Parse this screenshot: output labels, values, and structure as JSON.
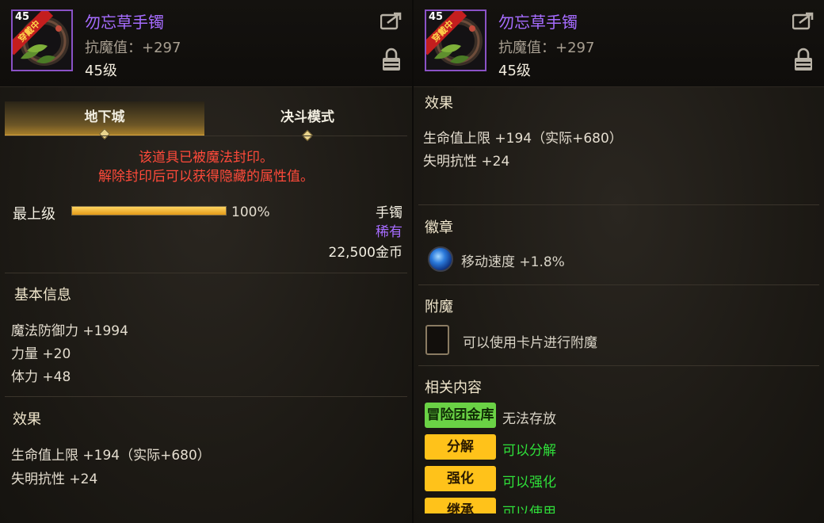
{
  "item": {
    "name": "勿忘草手镯",
    "stat": "抗魔值：+297",
    "level": "45级",
    "level_tag": "45",
    "equipped_ribbon": "穿戴中"
  },
  "left": {
    "tabs": [
      {
        "label": "地下城",
        "active": true
      },
      {
        "label": "决斗模式",
        "active": false
      }
    ],
    "seal_message": [
      "该道具已被魔法封印。",
      "解除封印后可以获得隐藏的属性值。"
    ],
    "upgrade": {
      "label": "最上级",
      "percent_text": "100%",
      "progress": 1.0
    },
    "category": "手镯",
    "rarity": "稀有",
    "price": "22,500金币",
    "basic_info": {
      "title": "基本信息",
      "lines": [
        "魔法防御力 +1994",
        "力量 +20",
        "体力 +48"
      ]
    },
    "effects": {
      "title": "效果",
      "lines": [
        "生命值上限 +194（实际+680）",
        "失明抗性 +24"
      ]
    }
  },
  "right": {
    "effects": {
      "title": "效果",
      "lines": [
        "生命值上限 +194（实际+680）",
        "失明抗性 +24"
      ]
    },
    "emblem": {
      "title": "徽章",
      "text": "移动速度 +1.8%"
    },
    "enchant": {
      "title": "附魔",
      "text": "可以使用卡片进行附魔"
    },
    "related": {
      "title": "相关内容",
      "rows": [
        {
          "badge": "冒险团金库",
          "status": "无法存放"
        },
        {
          "badge": "分解",
          "status": "可以分解"
        },
        {
          "badge": "强化",
          "status": "可以强化"
        },
        {
          "badge": "继承",
          "status": "可以使用"
        }
      ]
    }
  },
  "colors": {
    "item_name": "#a66cff",
    "rarity": "#a66cff",
    "seal_text": "#ff4a3a",
    "status_ok": "#2fe03a",
    "status_disabled": "#d8d3c6",
    "badge_green": "#6ad245",
    "badge_yellow": "#ffc21a"
  }
}
